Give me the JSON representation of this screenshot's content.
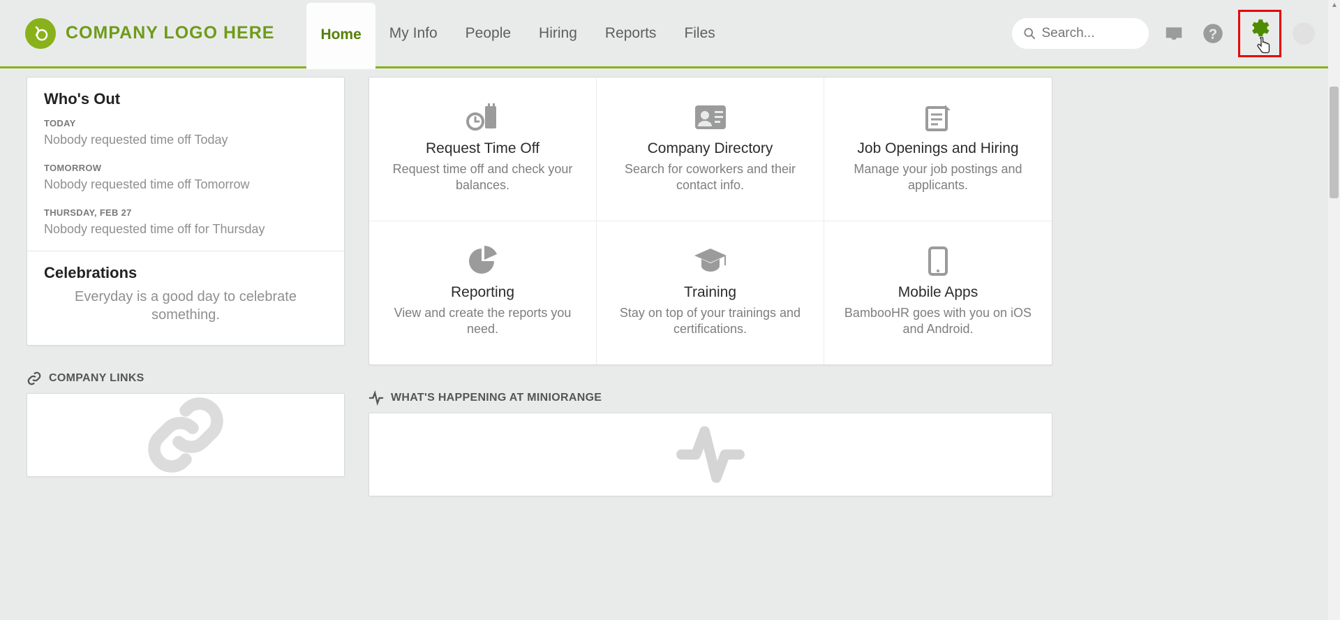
{
  "logo_text": "COMPANY LOGO HERE",
  "nav": {
    "home": "Home",
    "my_info": "My Info",
    "people": "People",
    "hiring": "Hiring",
    "reports": "Reports",
    "files": "Files"
  },
  "search": {
    "placeholder": "Search..."
  },
  "sidebar": {
    "whos_out_title": "Who's Out",
    "days": [
      {
        "label": "TODAY",
        "text": "Nobody requested time off Today"
      },
      {
        "label": "TOMORROW",
        "text": "Nobody requested time off Tomorrow"
      },
      {
        "label": "THURSDAY, FEB 27",
        "text": "Nobody requested time off for Thursday"
      }
    ],
    "celebrations_title": "Celebrations",
    "celebrations_text": "Everyday is a good day to celebrate something."
  },
  "actions": {
    "a0": {
      "title": "Request Time Off",
      "desc": "Request time off and check your balances."
    },
    "a1": {
      "title": "Company Directory",
      "desc": "Search for coworkers and their contact info."
    },
    "a2": {
      "title": "Job Openings and Hiring",
      "desc": "Manage your job postings and applicants."
    },
    "a3": {
      "title": "Reporting",
      "desc": "View and create the reports you need."
    },
    "a4": {
      "title": "Training",
      "desc": "Stay on top of your trainings and certifications."
    },
    "a5": {
      "title": "Mobile Apps",
      "desc": "BambooHR goes with you on iOS and Android."
    }
  },
  "sections": {
    "company_links": "COMPANY LINKS",
    "whats_happening": "WHAT'S HAPPENING AT MINIORANGE"
  }
}
